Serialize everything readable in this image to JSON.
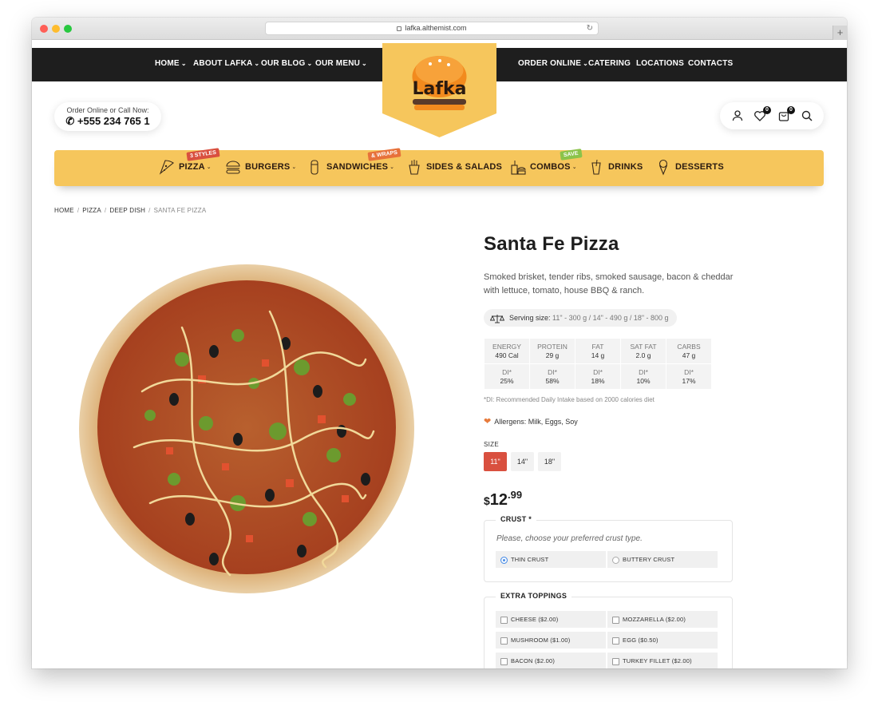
{
  "browser": {
    "url": "lafka.althemist.com"
  },
  "nav": {
    "left": [
      {
        "label": "HOME"
      },
      {
        "label": "ABOUT LAFKA"
      },
      {
        "label": "OUR BLOG"
      },
      {
        "label": "OUR MENU"
      }
    ],
    "right": [
      {
        "label": "ORDER ONLINE"
      },
      {
        "label": "CATERING"
      },
      {
        "label": "LOCATIONS"
      },
      {
        "label": "CONTACTS"
      }
    ]
  },
  "logo": {
    "text": "Lafka"
  },
  "contact": {
    "prompt": "Order Online or Call Now:",
    "phone": "+555 234 765 1"
  },
  "header_icons": {
    "wishlist_count": "0",
    "cart_count": "0"
  },
  "categories": [
    {
      "label": "PIZZA",
      "tag": "3 STYLES"
    },
    {
      "label": "BURGERS"
    },
    {
      "label": "SANDWICHES",
      "tag": "& WRAPS"
    },
    {
      "label": "SIDES & SALADS"
    },
    {
      "label": "COMBOS",
      "tag": "SAVE"
    },
    {
      "label": "DRINKS"
    },
    {
      "label": "DESSERTS"
    }
  ],
  "breadcrumb": [
    "HOME",
    "PIZZA",
    "DEEP DISH",
    "SANTA FE PIZZA"
  ],
  "product": {
    "title": "Santa Fe Pizza",
    "description": "Smoked brisket, tender ribs, smoked sausage, bacon & cheddar with lettuce, tomato, house BBQ & ranch.",
    "serving_label": "Serving size:",
    "serving_value": "11\" - 300 g / 14\" - 490 g / 18\" - 800 g",
    "nutrition": [
      {
        "name": "ENERGY",
        "value": "490 Cal",
        "di_label": "DI*",
        "di": "25%"
      },
      {
        "name": "PROTEIN",
        "value": "29 g",
        "di_label": "DI*",
        "di": "58%"
      },
      {
        "name": "FAT",
        "value": "14 g",
        "di_label": "DI*",
        "di": "18%"
      },
      {
        "name": "SAT FAT",
        "value": "2.0 g",
        "di_label": "DI*",
        "di": "10%"
      },
      {
        "name": "CARBS",
        "value": "47 g",
        "di_label": "DI*",
        "di": "17%"
      }
    ],
    "nutrition_note": "*DI: Recommended Daily Intake based on 2000 calories diet",
    "allergens": "Allergens: Milk, Eggs, Soy",
    "size_label": "SIZE",
    "sizes": [
      "11\"",
      "14\"",
      "18\""
    ],
    "selected_size": "11\"",
    "price_currency": "$",
    "price_whole": "12",
    "price_cents": ".99",
    "crust": {
      "legend": "CRUST *",
      "hint": "Please, choose your preferred crust type.",
      "options": [
        "THIN CRUST",
        "BUTTERY CRUST"
      ],
      "selected": "THIN CRUST"
    },
    "toppings": {
      "legend": "EXTRA TOPPINGS",
      "options": [
        "CHEESE ($2.00)",
        "MOZZARELLA ($2.00)",
        "MUSHROOM ($1.00)",
        "EGG ($0.50)",
        "BACON ($2.00)",
        "TURKEY FILLET ($2.00)"
      ]
    }
  },
  "colors": {
    "accent_yellow": "#f6c65c",
    "accent_red": "#d9503f",
    "nav_dark": "#1e1e1e"
  }
}
